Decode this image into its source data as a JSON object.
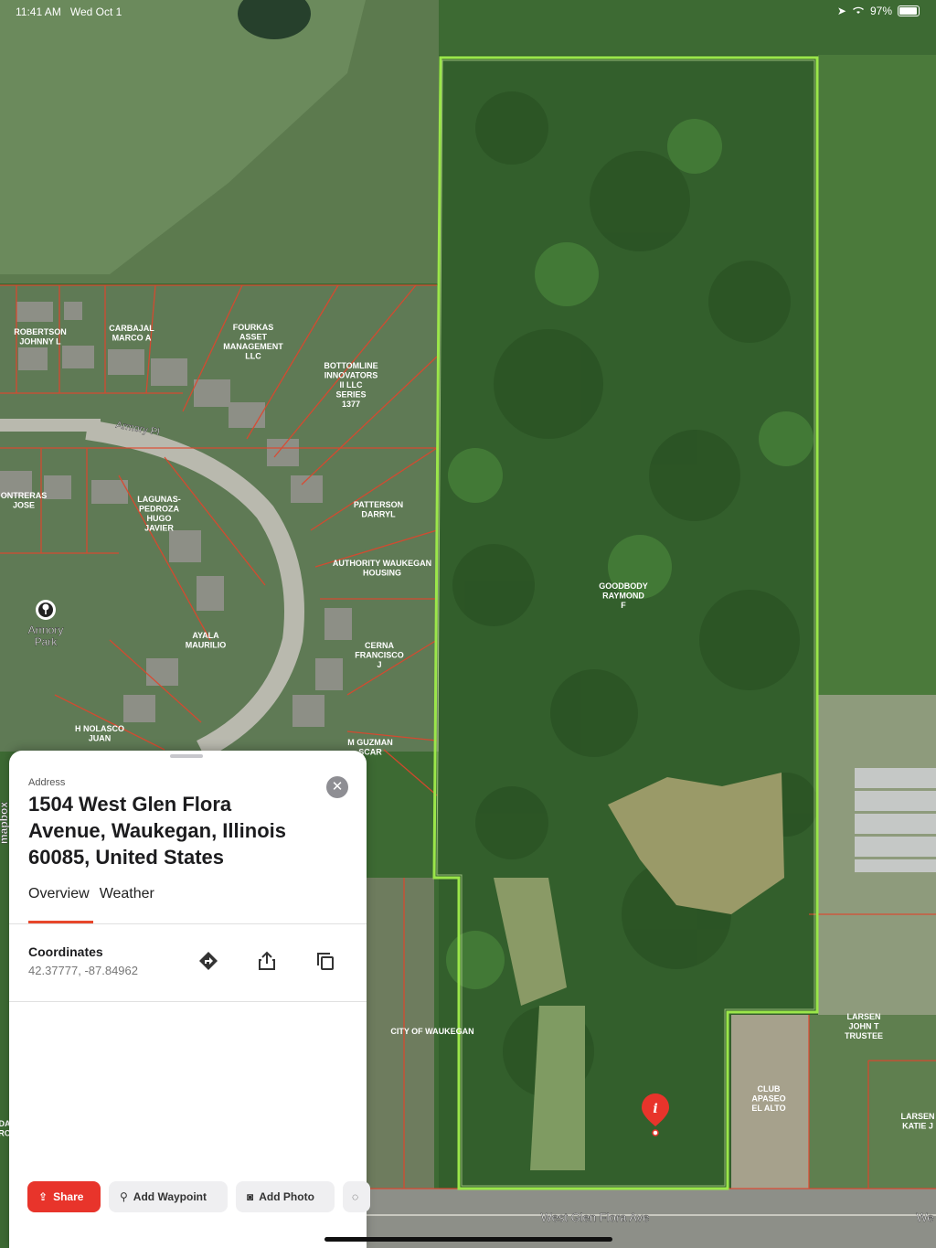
{
  "status_bar": {
    "time": "11:41 AM",
    "date": "Wed Oct 1",
    "battery": "97%",
    "icons": [
      "location-arrow-icon",
      "wifi-icon",
      "battery-icon"
    ]
  },
  "map": {
    "park_name": "Armory Park",
    "street_labels": [
      "Armory Pl",
      "West Glen Flora Ave",
      "We"
    ],
    "attribution": "mapbox",
    "parcel_owners": [
      [
        "ROBERTSON",
        "JOHNNY L"
      ],
      [
        "CARBAJAL",
        "MARCO A"
      ],
      [
        "FOURKAS",
        "ASSET",
        "MANAGEMENT",
        "LLC"
      ],
      [
        "BOTTOMLINE",
        "INNOVATORS",
        "II LLC",
        "SERIES",
        "1377"
      ],
      [
        "ONTRERAS",
        "JOSE"
      ],
      [
        "LAGUNAS-",
        "PEDROZA",
        "HUGO",
        "JAVIER"
      ],
      [
        "PATTERSON",
        "DARRYL"
      ],
      [
        "AUTHORITY WAUKEGAN",
        "HOUSING"
      ],
      [
        "AYALA",
        "MAURILIO"
      ],
      [
        "CERNA",
        "FRANCISCO",
        "J"
      ],
      [
        "H NOLASCO",
        "JUAN"
      ],
      [
        "M GUZMAN",
        "SCAR"
      ],
      [
        "GOODBODY",
        "RAYMOND",
        "F"
      ],
      [
        "CITY OF WAUKEGAN"
      ],
      [
        "LARSEN",
        "JOHN T",
        "TRUSTEE"
      ],
      [
        "CLUB",
        "APASEO",
        "EL ALTO"
      ],
      [
        "LARSEN",
        "KATIE J"
      ],
      [
        "DA",
        "RO"
      ]
    ],
    "colors": {
      "selected_parcel": "#9be64a",
      "parcel_lines": "#e0452c",
      "pin": "#e8342b"
    }
  },
  "sheet": {
    "address_label": "Address",
    "address": "1504 West Glen Flora Avenue, Waukegan, Illinois 60085, United States",
    "tabs": [
      "Overview",
      "Weather"
    ],
    "active_tab": "Overview",
    "coordinates_label": "Coordinates",
    "coordinates_value": "42.37777, -87.84962",
    "coordinate_actions": [
      "directions-icon",
      "share-icon",
      "copy-icon"
    ],
    "actions": [
      {
        "label": "Share",
        "icon": "share-icon",
        "style": "primary"
      },
      {
        "label": "Add Waypoint",
        "icon": "pin-icon",
        "style": "secondary"
      },
      {
        "label": "Add Photo",
        "icon": "camera-icon",
        "style": "secondary"
      }
    ],
    "accent": "#e8342b"
  }
}
